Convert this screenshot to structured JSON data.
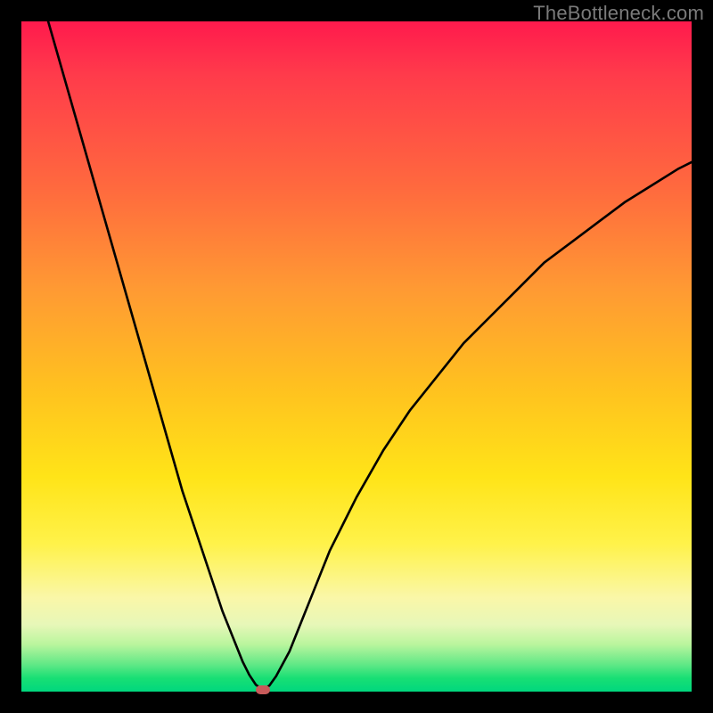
{
  "watermark": "TheBottleneck.com",
  "chart_data": {
    "type": "line",
    "title": "",
    "xlabel": "",
    "ylabel": "",
    "xlim": [
      0,
      100
    ],
    "ylim": [
      0,
      100
    ],
    "grid": false,
    "series": [
      {
        "name": "curve",
        "x": [
          4,
          6,
          8,
          10,
          12,
          14,
          16,
          18,
          20,
          22,
          24,
          26,
          28,
          30,
          32,
          33,
          34,
          35,
          36,
          37,
          38,
          40,
          42,
          44,
          46,
          48,
          50,
          54,
          58,
          62,
          66,
          70,
          74,
          78,
          82,
          86,
          90,
          94,
          98,
          100
        ],
        "y": [
          100,
          93,
          86,
          79,
          72,
          65,
          58,
          51,
          44,
          37,
          30,
          24,
          18,
          12,
          7,
          4.5,
          2.5,
          1,
          0.3,
          0.9,
          2.3,
          6,
          11,
          16,
          21,
          25,
          29,
          36,
          42,
          47,
          52,
          56,
          60,
          64,
          67,
          70,
          73,
          75.5,
          78,
          79
        ]
      }
    ],
    "marker": {
      "x": 36,
      "y": 0.3
    },
    "background_gradient": {
      "orientation": "vertical",
      "stops": [
        {
          "pos": 0.0,
          "color": "#ff1a4d"
        },
        {
          "pos": 0.25,
          "color": "#ff6a3e"
        },
        {
          "pos": 0.55,
          "color": "#ffc21f"
        },
        {
          "pos": 0.78,
          "color": "#fff24a"
        },
        {
          "pos": 0.9,
          "color": "#e7f7b8"
        },
        {
          "pos": 1.0,
          "color": "#00d77e"
        }
      ]
    }
  }
}
